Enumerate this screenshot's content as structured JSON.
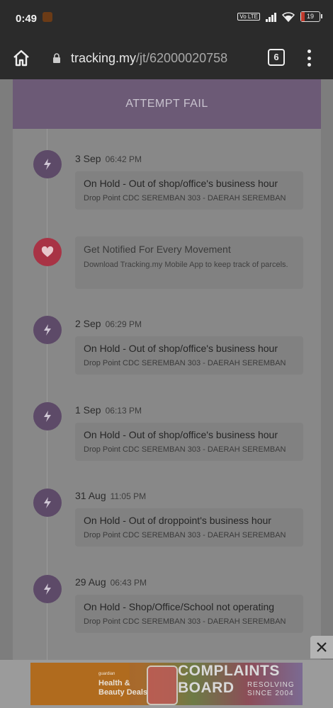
{
  "status_bar": {
    "time": "0:49",
    "battery": "19",
    "volte": "Vo LTE"
  },
  "browser": {
    "url_host": "tracking.my",
    "url_path": "/jt/62000020758",
    "tab_count": "6"
  },
  "banner": {
    "label": "ATTEMPT FAIL"
  },
  "events": [
    {
      "date": "3 Sep",
      "time": "06:42 PM",
      "status": "On Hold - Out of shop/office's business hour",
      "location": "Drop Point CDC SEREMBAN 303 - DAERAH SEREMBAN"
    },
    {
      "date": "2 Sep",
      "time": "06:29 PM",
      "status": "On Hold - Out of shop/office's business hour",
      "location": "Drop Point CDC SEREMBAN 303 - DAERAH SEREMBAN"
    },
    {
      "date": "1 Sep",
      "time": "06:13 PM",
      "status": "On Hold - Out of shop/office's business hour",
      "location": "Drop Point CDC SEREMBAN 303 - DAERAH SEREMBAN"
    },
    {
      "date": "31 Aug",
      "time": "11:05 PM",
      "status": "On Hold - Out of droppoint's business hour",
      "location": "Drop Point CDC SEREMBAN 303 - DAERAH SEREMBAN"
    },
    {
      "date": "29 Aug",
      "time": "06:43 PM",
      "status": "On Hold - Shop/Office/School not operating",
      "location": "Drop Point CDC SEREMBAN 303 - DAERAH SEREMBAN"
    }
  ],
  "promo": {
    "title": "Get Notified For Every Movement",
    "text": "Download Tracking.my Mobile App to keep track of parcels."
  },
  "ad": {
    "brand": "guardian",
    "headline": "Health & Beauty Deals",
    "watermark_1": "COMPLAINTS",
    "watermark_2": "BOARD",
    "watermark_3": "RESOLVING",
    "watermark_4": "SINCE 2004"
  },
  "colors": {
    "banner": "#6c5a76",
    "event_icon": "#5d4a68",
    "heart_icon": "#a83345"
  }
}
